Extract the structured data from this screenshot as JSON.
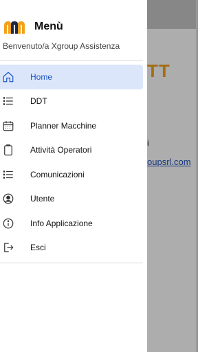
{
  "background": {
    "title_fragment": "TT",
    "text_fragment": "i",
    "link_fragment": "oupsrl.com"
  },
  "drawer": {
    "title": "Menù",
    "welcome": "Benvenuto/a Xgroup Assistenza",
    "items": [
      {
        "label": "Home",
        "icon": "home-icon",
        "active": true
      },
      {
        "label": "DDT",
        "icon": "list-icon",
        "active": false
      },
      {
        "label": "Planner Macchine",
        "icon": "calendar-icon",
        "active": false
      },
      {
        "label": "Attività Operatori",
        "icon": "clipboard-icon",
        "active": false
      },
      {
        "label": "Comunicazioni",
        "icon": "list-icon",
        "active": false
      },
      {
        "label": "Utente",
        "icon": "user-circle-icon",
        "active": false
      },
      {
        "label": "Info Applicazione",
        "icon": "info-icon",
        "active": false
      },
      {
        "label": "Esci",
        "icon": "logout-icon",
        "active": false
      }
    ]
  },
  "colors": {
    "accent": "#1a55c9",
    "active_bg": "#dce6fa",
    "brand_orange": "#f2a21d",
    "logo_dark": "#1b2a4a"
  }
}
